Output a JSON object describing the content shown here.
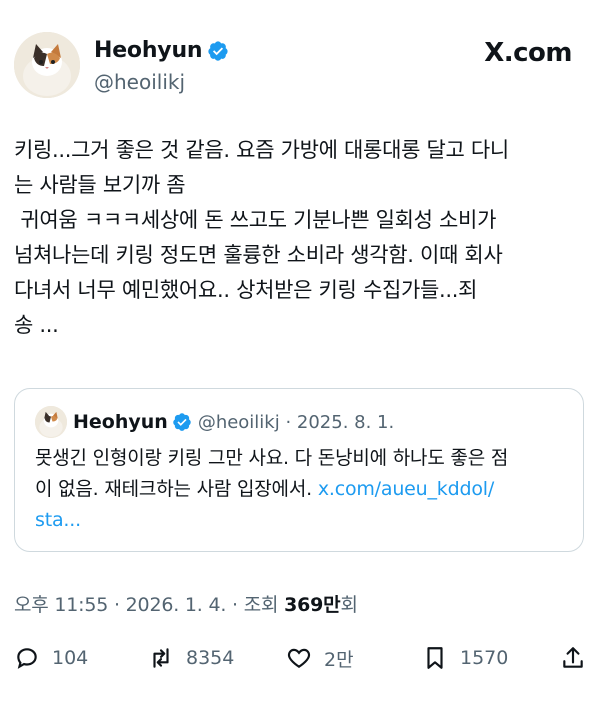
{
  "author": {
    "name": "Heohyun",
    "handle": "@heoilikj",
    "avatar_icon": "cat-avatar-icon",
    "verified_color": "#1d9bf0"
  },
  "brand": "X.com",
  "tweet": {
    "text": "키링...그거 좋은 것 같음. 요즘 가방에 대롱대롱 달고 다니\n는 사람들 보기까 좀\n 귀여움 ㅋㅋㅋ세상에 돈 쓰고도 기분나쁜 일회성 소비가\n넘쳐나는데 키링 정도면 훌륭한 소비라 생각함. 이때 회사\n다녀서 너무 예민했어요.. 상처받은 키링 수집가들...죄\n송 ..."
  },
  "quote": {
    "name": "Heohyun",
    "meta": "@heoilikj · 2025. 8. 1.",
    "text": "못생긴 인형이랑 키링 그만 사요. 다 돈낭비에 하나도 좋은 점\n이 없음. 재테크하는 사람 입장에서. ",
    "link": "x.com/aueu_kddol/\nsta..."
  },
  "timestamp": {
    "time": "오후 11:55 · 2026. 1. 4. · 조회 ",
    "views": "369만",
    "views_suffix": "회"
  },
  "actions": {
    "reply_count": "104",
    "retweet_count": "8354",
    "like_count": "2만",
    "bookmark_count": "1570"
  }
}
